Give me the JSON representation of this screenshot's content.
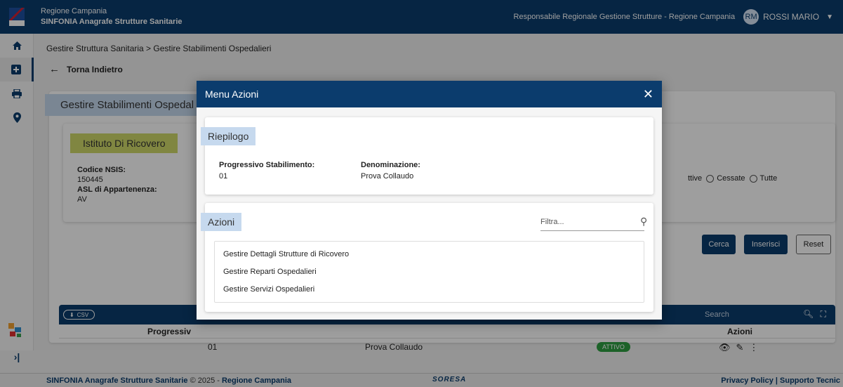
{
  "header": {
    "region": "Regione Campania",
    "app_title": "SINFONIA Anagrafe Strutture Sanitarie",
    "role": "Responsabile Regionale Gestione Strutture - Regione Campania",
    "avatar_initials": "RM",
    "user_name": "ROSSI MARIO"
  },
  "nav_icons": [
    "home-icon",
    "hospital-plus-icon",
    "printer-icon",
    "map-pin-icon"
  ],
  "page": {
    "breadcrumb": "Gestire Struttura Sanitaria > Gestire Stabilimenti Ospedalieri",
    "back_label": "Torna Indietro",
    "panel_title": "Gestire Stabilimenti Ospedal",
    "istituto_title": "Istituto Di Ricovero",
    "codice_label": "Codice NSIS:",
    "codice_value": "150445",
    "asl_label": "ASL di Appartenenza:",
    "asl_value": "AV",
    "radio_attive": "ttive",
    "radio_cessate": "Cessate",
    "radio_tutte": "Tutte"
  },
  "buttons": {
    "cerca": "Cerca",
    "inserisci": "Inserisci",
    "reset": "Reset"
  },
  "table": {
    "csv_label": "CSV",
    "search_placeholder": "Search",
    "col_progressivo": "Progressiv",
    "col_azioni": "Azioni",
    "row": {
      "progressivo": "01",
      "denominazione": "Prova Collaudo",
      "stato": "ATTIVO"
    }
  },
  "footer": {
    "left_bold": "SINFONIA Anagrafe Strutture Sanitarie",
    "copyright": "© 2025 -",
    "region": "Regione Campania",
    "brand": "SORESA",
    "links": "Privacy Policy | Supporto Tecnic"
  },
  "modal": {
    "title": "Menu Azioni",
    "close_symbol": "✕",
    "riepilogo_title": "Riepilogo",
    "progressivo_label": "Progressivo Stabilimento:",
    "progressivo_value": "01",
    "denominazione_label": "Denominazione:",
    "denominazione_value": "Prova Collaudo",
    "azioni_title": "Azioni",
    "filter_placeholder": "Filtra...",
    "actions": [
      "Gestire Dettagli Strutture di Ricovero",
      "Gestire Reparti Ospedalieri",
      "Gestire Servizi Ospedalieri"
    ]
  },
  "colors": {
    "primary": "#0b3c6d",
    "tag_blue": "#c6d9ee",
    "tag_yellow": "#cfd96a",
    "badge_green": "#2e9e42"
  }
}
